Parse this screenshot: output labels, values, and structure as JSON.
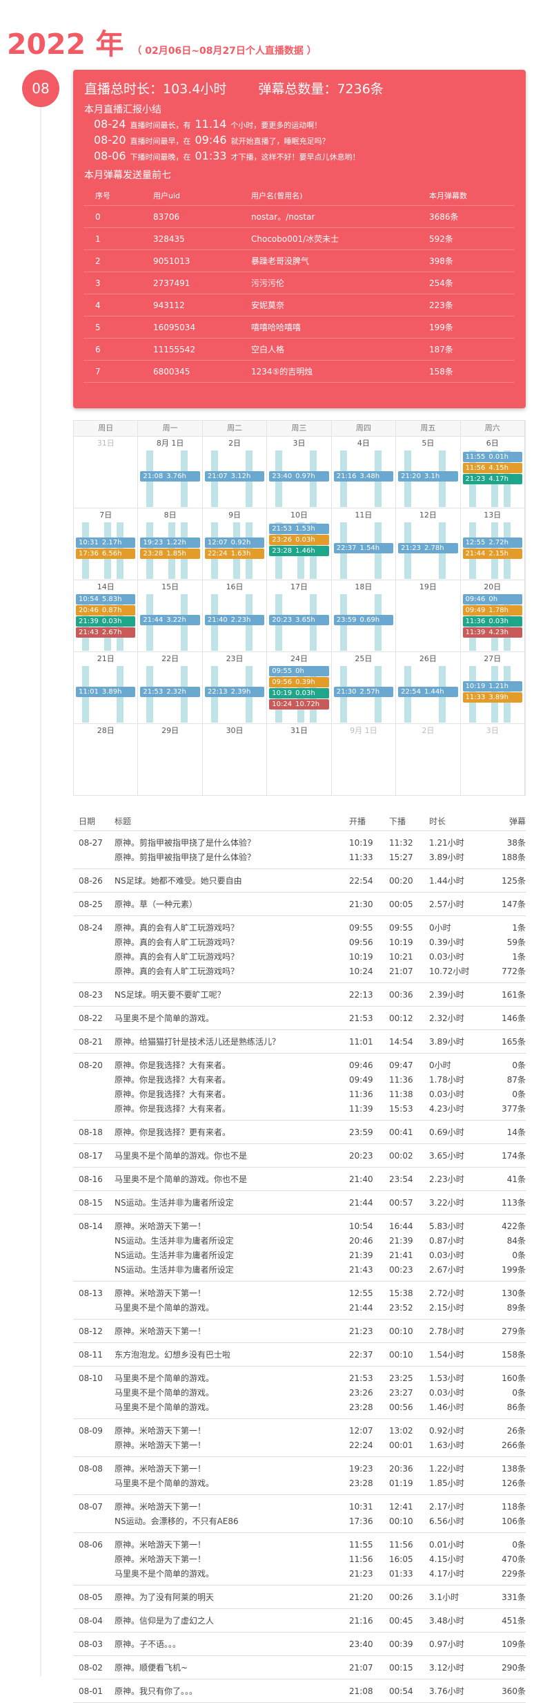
{
  "header": {
    "year": "2022 年",
    "range": "（ 02月06日~08月27日个人直播数据 ）"
  },
  "month": "08",
  "summary": {
    "total_hours": "直播总时长：103.4小时",
    "total_danmaku": "弹幕总数量：7236条",
    "report_title": "本月直播汇报小结",
    "highlights": [
      {
        "date": "08-24",
        "pre": "直播时间最长，有",
        "val": "11.14",
        "post": "个小时，要更多的运动啊！"
      },
      {
        "date": "08-20",
        "pre": "直播时间最早，在",
        "val": "09:46",
        "post": "就开始直播了，睡眠充足吗？"
      },
      {
        "date": "08-06",
        "pre": "下播时间最晚，在",
        "val": "01:33",
        "post": "才下播，这样不好！要早点儿休息哟！"
      }
    ],
    "top_title": "本月弹幕发送量前七",
    "top_headers": [
      "序号",
      "用户uid",
      "用户名(曾用名)",
      "本月弹幕数"
    ],
    "top": [
      [
        "0",
        "83706",
        "nostar。/nostar",
        "3686条"
      ],
      [
        "1",
        "328435",
        "Chocobo001/冰荧未士",
        "592条"
      ],
      [
        "2",
        "9051013",
        "暴躁老哥没脾气",
        "398条"
      ],
      [
        "3",
        "2737491",
        "污污污伦",
        "254条"
      ],
      [
        "4",
        "943112",
        "安妮莫奈",
        "223条"
      ],
      [
        "5",
        "16095034",
        "嘻嘻哈哈嘻嘻",
        "199条"
      ],
      [
        "6",
        "11155542",
        "空白人格",
        "187条"
      ],
      [
        "7",
        "6800345",
        "1234⑤的吉明烛",
        "158条"
      ]
    ]
  },
  "calendar": {
    "colors": {
      "blue": "#6aa8cf",
      "orange": "#e39b2a",
      "green": "#1fa58a",
      "red": "#c95a5a"
    },
    "weekdays": [
      "周日",
      "周一",
      "周二",
      "周三",
      "周四",
      "周五",
      "周六"
    ],
    "weeks": [
      {
        "days": [
          "31日",
          "8月 1日",
          "2日",
          "3日",
          "4日",
          "5日",
          "6日"
        ],
        "grey": [
          0
        ],
        "events": [
          {
            "d": 1,
            "r": 0,
            "t": "21:08",
            "h": "3.76h",
            "c": "blue"
          },
          {
            "d": 2,
            "r": 0,
            "t": "21:07",
            "h": "3.12h",
            "c": "blue"
          },
          {
            "d": 3,
            "r": 0,
            "t": "23:40",
            "h": "0.97h",
            "c": "blue"
          },
          {
            "d": 4,
            "r": 0,
            "t": "21:16",
            "h": "3.48h",
            "c": "blue"
          },
          {
            "d": 5,
            "r": 0,
            "t": "21:20",
            "h": "3.1h",
            "c": "blue"
          },
          {
            "d": 6,
            "r": 0,
            "t": "11:55",
            "h": "0.01h",
            "c": "blue"
          },
          {
            "d": 6,
            "r": 1,
            "t": "11:56",
            "h": "4.15h",
            "c": "orange"
          },
          {
            "d": 6,
            "r": 2,
            "t": "21:23",
            "h": "4.17h",
            "c": "green"
          }
        ]
      },
      {
        "days": [
          "7日",
          "8日",
          "9日",
          "10日",
          "11日",
          "12日",
          "13日"
        ],
        "grey": [],
        "events": [
          {
            "d": 0,
            "r": 0,
            "t": "10:31",
            "h": "2.17h",
            "c": "blue"
          },
          {
            "d": 0,
            "r": 1,
            "t": "17:36",
            "h": "6.56h",
            "c": "orange"
          },
          {
            "d": 1,
            "r": 0,
            "t": "19:23",
            "h": "1.22h",
            "c": "blue"
          },
          {
            "d": 1,
            "r": 1,
            "t": "23:28",
            "h": "1.85h",
            "c": "orange"
          },
          {
            "d": 2,
            "r": 0,
            "t": "12:07",
            "h": "0.92h",
            "c": "blue"
          },
          {
            "d": 2,
            "r": 1,
            "t": "22:24",
            "h": "1.63h",
            "c": "orange"
          },
          {
            "d": 3,
            "r": 0,
            "t": "21:53",
            "h": "1.53h",
            "c": "blue"
          },
          {
            "d": 3,
            "r": 1,
            "t": "23:26",
            "h": "0.03h",
            "c": "orange"
          },
          {
            "d": 3,
            "r": 2,
            "t": "23:28",
            "h": "1.46h",
            "c": "green"
          },
          {
            "d": 4,
            "r": 0,
            "t": "22:37",
            "h": "1.54h",
            "c": "blue"
          },
          {
            "d": 5,
            "r": 0,
            "t": "21:23",
            "h": "2.78h",
            "c": "blue"
          },
          {
            "d": 6,
            "r": 0,
            "t": "12:55",
            "h": "2.72h",
            "c": "blue"
          },
          {
            "d": 6,
            "r": 1,
            "t": "21:44",
            "h": "2.15h",
            "c": "orange"
          }
        ]
      },
      {
        "days": [
          "14日",
          "15日",
          "16日",
          "17日",
          "18日",
          "19日",
          "20日"
        ],
        "grey": [],
        "events": [
          {
            "d": 0,
            "r": 0,
            "t": "10:54",
            "h": "5.83h",
            "c": "blue"
          },
          {
            "d": 0,
            "r": 1,
            "t": "20:46",
            "h": "0.87h",
            "c": "orange"
          },
          {
            "d": 0,
            "r": 2,
            "t": "21:39",
            "h": "0.03h",
            "c": "green"
          },
          {
            "d": 0,
            "r": 3,
            "t": "21:43",
            "h": "2.67h",
            "c": "red"
          },
          {
            "d": 1,
            "r": 0,
            "t": "21:44",
            "h": "3.22h",
            "c": "blue"
          },
          {
            "d": 2,
            "r": 0,
            "t": "21:40",
            "h": "2.23h",
            "c": "blue"
          },
          {
            "d": 3,
            "r": 0,
            "t": "20:23",
            "h": "3.65h",
            "c": "blue"
          },
          {
            "d": 4,
            "r": 0,
            "t": "23:59",
            "h": "0.69h",
            "c": "blue"
          },
          {
            "d": 6,
            "r": 0,
            "t": "09:46",
            "h": "0h",
            "c": "blue"
          },
          {
            "d": 6,
            "r": 1,
            "t": "09:49",
            "h": "1.78h",
            "c": "orange"
          },
          {
            "d": 6,
            "r": 2,
            "t": "11:36",
            "h": "0.03h",
            "c": "green"
          },
          {
            "d": 6,
            "r": 3,
            "t": "11:39",
            "h": "4.23h",
            "c": "red"
          }
        ]
      },
      {
        "days": [
          "21日",
          "22日",
          "23日",
          "24日",
          "25日",
          "26日",
          "27日"
        ],
        "grey": [],
        "events": [
          {
            "d": 0,
            "r": 0,
            "t": "11:01",
            "h": "3.89h",
            "c": "blue"
          },
          {
            "d": 1,
            "r": 0,
            "t": "21:53",
            "h": "2.32h",
            "c": "blue"
          },
          {
            "d": 2,
            "r": 0,
            "t": "22:13",
            "h": "2.39h",
            "c": "blue"
          },
          {
            "d": 3,
            "r": 0,
            "t": "09:55",
            "h": "0h",
            "c": "blue"
          },
          {
            "d": 3,
            "r": 1,
            "t": "09:56",
            "h": "0.39h",
            "c": "orange"
          },
          {
            "d": 3,
            "r": 2,
            "t": "10:19",
            "h": "0.03h",
            "c": "green"
          },
          {
            "d": 3,
            "r": 3,
            "t": "10:24",
            "h": "10.72h",
            "c": "red"
          },
          {
            "d": 4,
            "r": 0,
            "t": "21:30",
            "h": "2.57h",
            "c": "blue"
          },
          {
            "d": 5,
            "r": 0,
            "t": "22:54",
            "h": "1.44h",
            "c": "blue"
          },
          {
            "d": 6,
            "r": 0,
            "t": "10:19",
            "h": "1.21h",
            "c": "blue"
          },
          {
            "d": 6,
            "r": 1,
            "t": "11:33",
            "h": "3.89h",
            "c": "orange"
          }
        ]
      },
      {
        "days": [
          "28日",
          "29日",
          "30日",
          "31日",
          "9月 1日",
          "2日",
          "3日"
        ],
        "grey": [
          4,
          5,
          6
        ],
        "events": []
      }
    ]
  },
  "table": {
    "headers": [
      "日期",
      "标题",
      "开播",
      "下播",
      "时长",
      "弹幕"
    ],
    "groups": [
      {
        "date": "08-27",
        "rows": [
          [
            "原神。剪指甲被指甲挠了是什么体验？",
            "10:19",
            "11:32",
            "1.21小时",
            "38条"
          ],
          [
            "原神。剪指甲被指甲挠了是什么体验？",
            "11:33",
            "15:27",
            "3.89小时",
            "188条"
          ]
        ]
      },
      {
        "date": "08-26",
        "rows": [
          [
            "NS足球。她都不难受。她只要自由",
            "22:54",
            "00:20",
            "1.44小时",
            "125条"
          ]
        ]
      },
      {
        "date": "08-25",
        "rows": [
          [
            "原神。草（一种元素）",
            "21:30",
            "00:05",
            "2.57小时",
            "147条"
          ]
        ]
      },
      {
        "date": "08-24",
        "rows": [
          [
            "原神。真的会有人旷工玩游戏吗？",
            "09:55",
            "09:55",
            "0小时",
            "1条"
          ],
          [
            "原神。真的会有人旷工玩游戏吗？",
            "09:56",
            "10:19",
            "0.39小时",
            "59条"
          ],
          [
            "原神。真的会有人旷工玩游戏吗？",
            "10:19",
            "10:21",
            "0.03小时",
            "1条"
          ],
          [
            "原神。真的会有人旷工玩游戏吗？",
            "10:24",
            "21:07",
            "10.72小时",
            "772条"
          ]
        ]
      },
      {
        "date": "08-23",
        "rows": [
          [
            "NS足球。明天要不要旷工呢？",
            "22:13",
            "00:36",
            "2.39小时",
            "161条"
          ]
        ]
      },
      {
        "date": "08-22",
        "rows": [
          [
            "马里奥不是个简单的游戏。",
            "21:53",
            "00:12",
            "2.32小时",
            "146条"
          ]
        ]
      },
      {
        "date": "08-21",
        "rows": [
          [
            "原神。给猫猫打针是技术活儿还是熟练活儿？",
            "11:01",
            "14:54",
            "3.89小时",
            "165条"
          ]
        ]
      },
      {
        "date": "08-20",
        "rows": [
          [
            "原神。你是我选择？大有来者。",
            "09:46",
            "09:47",
            "0小时",
            "0条"
          ],
          [
            "原神。你是我选择？大有来者。",
            "09:49",
            "11:36",
            "1.78小时",
            "87条"
          ],
          [
            "原神。你是我选择？大有来者。",
            "11:36",
            "11:38",
            "0.03小时",
            "0条"
          ],
          [
            "原神。你是我选择？大有来者。",
            "11:39",
            "15:53",
            "4.23小时",
            "377条"
          ]
        ]
      },
      {
        "date": "08-18",
        "rows": [
          [
            "原神。你是我选择？更有来者。",
            "23:59",
            "00:41",
            "0.69小时",
            "14条"
          ]
        ]
      },
      {
        "date": "08-17",
        "rows": [
          [
            "马里奥不是个简单的游戏。你也不是",
            "20:23",
            "00:02",
            "3.65小时",
            "174条"
          ]
        ]
      },
      {
        "date": "08-16",
        "rows": [
          [
            "马里奥不是个简单的游戏。你也不是",
            "21:40",
            "23:54",
            "2.23小时",
            "41条"
          ]
        ]
      },
      {
        "date": "08-15",
        "rows": [
          [
            "NS运动。生活并非为庸者所设定",
            "21:44",
            "00:57",
            "3.22小时",
            "113条"
          ]
        ]
      },
      {
        "date": "08-14",
        "rows": [
          [
            "原神。米哈游天下第一！",
            "10:54",
            "16:44",
            "5.83小时",
            "422条"
          ],
          [
            "NS运动。生活并非为庸者所设定",
            "20:46",
            "21:39",
            "0.87小时",
            "84条"
          ],
          [
            "NS运动。生活并非为庸者所设定",
            "21:39",
            "21:41",
            "0.03小时",
            "0条"
          ],
          [
            "NS运动。生活并非为庸者所设定",
            "21:43",
            "00:23",
            "2.67小时",
            "199条"
          ]
        ]
      },
      {
        "date": "08-13",
        "rows": [
          [
            "原神。米哈游天下第一！",
            "12:55",
            "15:38",
            "2.72小时",
            "130条"
          ],
          [
            "马里奥不是个简单的游戏。",
            "21:44",
            "23:52",
            "2.15小时",
            "89条"
          ]
        ]
      },
      {
        "date": "08-12",
        "rows": [
          [
            "原神。米哈游天下第一！",
            "21:23",
            "00:10",
            "2.78小时",
            "279条"
          ]
        ]
      },
      {
        "date": "08-11",
        "rows": [
          [
            "东方泡泡龙。幻想乡没有巴士啦",
            "22:37",
            "00:10",
            "1.54小时",
            "158条"
          ]
        ]
      },
      {
        "date": "08-10",
        "rows": [
          [
            "马里奥不是个简单的游戏。",
            "21:53",
            "23:25",
            "1.53小时",
            "160条"
          ],
          [
            "马里奥不是个简单的游戏。",
            "23:26",
            "23:27",
            "0.03小时",
            "0条"
          ],
          [
            "马里奥不是个简单的游戏。",
            "23:28",
            "00:56",
            "1.46小时",
            "86条"
          ]
        ]
      },
      {
        "date": "08-09",
        "rows": [
          [
            "原神。米哈游天下第一！",
            "12:07",
            "13:02",
            "0.92小时",
            "26条"
          ],
          [
            "原神。米哈游天下第一！",
            "22:24",
            "00:01",
            "1.63小时",
            "266条"
          ]
        ]
      },
      {
        "date": "08-08",
        "rows": [
          [
            "原神。米哈游天下第一！",
            "19:23",
            "20:36",
            "1.22小时",
            "138条"
          ],
          [
            "马里奥不是个简单的游戏。",
            "23:28",
            "01:19",
            "1.85小时",
            "126条"
          ]
        ]
      },
      {
        "date": "08-07",
        "rows": [
          [
            "原神。米哈游天下第一！",
            "10:31",
            "12:41",
            "2.17小时",
            "118条"
          ],
          [
            "NS运动。会漂移的，不只有AE86",
            "17:36",
            "00:10",
            "6.56小时",
            "106条"
          ]
        ]
      },
      {
        "date": "08-06",
        "rows": [
          [
            "原神。米哈游天下第一！",
            "11:55",
            "11:56",
            "0.01小时",
            "0条"
          ],
          [
            "原神。米哈游天下第一！",
            "11:56",
            "16:05",
            "4.15小时",
            "470条"
          ],
          [
            "马里奥不是个简单的游戏。",
            "21:23",
            "01:33",
            "4.17小时",
            "229条"
          ]
        ]
      },
      {
        "date": "08-05",
        "rows": [
          [
            "原神。为了没有阿莱的明天",
            "21:20",
            "00:26",
            "3.1小时",
            "331条"
          ]
        ]
      },
      {
        "date": "08-04",
        "rows": [
          [
            "原神。信仰是为了虚幻之人",
            "21:16",
            "00:45",
            "3.48小时",
            "451条"
          ]
        ]
      },
      {
        "date": "08-03",
        "rows": [
          [
            "原神。子不语。。。",
            "23:40",
            "00:39",
            "0.97小时",
            "109条"
          ]
        ]
      },
      {
        "date": "08-02",
        "rows": [
          [
            "原神。顺便看飞机~",
            "21:07",
            "00:15",
            "3.12小时",
            "290条"
          ]
        ]
      },
      {
        "date": "08-01",
        "rows": [
          [
            "原神。我只有你了。。。",
            "21:08",
            "00:54",
            "3.76小时",
            "360条"
          ]
        ]
      }
    ]
  }
}
